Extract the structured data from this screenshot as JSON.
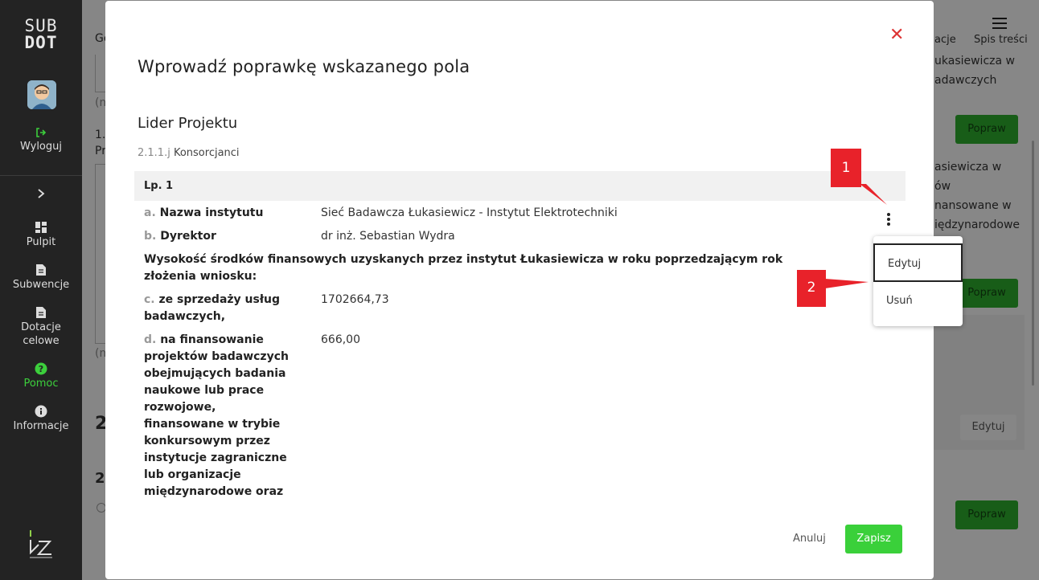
{
  "sidebar": {
    "logo_line1": "SUB",
    "logo_line2": "DOT",
    "logout": "Wyloguj",
    "items": [
      {
        "label": "Pulpit"
      },
      {
        "label": "Subwencje"
      },
      {
        "label": "Dotacje celowe"
      },
      {
        "label": "Pomoc"
      },
      {
        "label": "Informacje"
      }
    ]
  },
  "background": {
    "toc_label": "Spis treści",
    "toc_partial": "acje",
    "tab_partial": "Ge",
    "left_fragments": [
      "(m",
      "1.",
      "Pr",
      "(m",
      "2",
      "2."
    ],
    "right_text_1": [
      "ukasiewicza w",
      "adawczych"
    ],
    "right_text_2": [
      "asiewicza w",
      "ów",
      "nansowane w",
      "iędzynarodowe"
    ],
    "buttons": [
      "Popraw",
      "Popraw",
      "Edytuj",
      "Popraw"
    ]
  },
  "modal": {
    "close_glyph": "✕",
    "title": "Wprowadź poprawkę wskazanego pola",
    "section": "Lider Projektu",
    "path_num": "2.1.1.j",
    "path_label": "Konsorcjanci",
    "lp": "Lp. 1",
    "fields": {
      "a_letter": "a.",
      "a_label": "Nazwa instytutu",
      "a_value": "Sieć Badawcza Łukasiewicz - Instytut Elektrotechniki",
      "b_letter": "b.",
      "b_label": "Dyrektor",
      "b_value": "dr inż. Sebastian Wydra",
      "heading_line1": "Wysokość środków finansowych uzyskanych przez instytut Łukasiewicza w roku poprzedzającym rok",
      "heading_line2": "złożenia wniosku:",
      "c_letter": "c.",
      "c_label_1": "ze sprzedaży usług",
      "c_label_2": "badawczych,",
      "c_value": "1702664,73",
      "d_letter": "d.",
      "d_label_lines": [
        "na finansowanie",
        "projektów badawczych",
        "obejmujących badania",
        "naukowe lub prace",
        "rozwojowe,",
        "finansowane w trybie",
        "konkursowym przez",
        "instytucje zagraniczne",
        "lub organizacje",
        "międzynarodowe oraz"
      ],
      "d_value": "666,00"
    },
    "menu": {
      "edit": "Edytuj",
      "delete": "Usuń"
    },
    "callouts": [
      "1",
      "2"
    ],
    "cancel": "Anuluj",
    "save": "Zapisz"
  },
  "colors": {
    "accent_green": "#3ad03a",
    "close_red": "#dd3333",
    "callout_red": "#e8222a",
    "sidebar_bg": "#232323"
  }
}
